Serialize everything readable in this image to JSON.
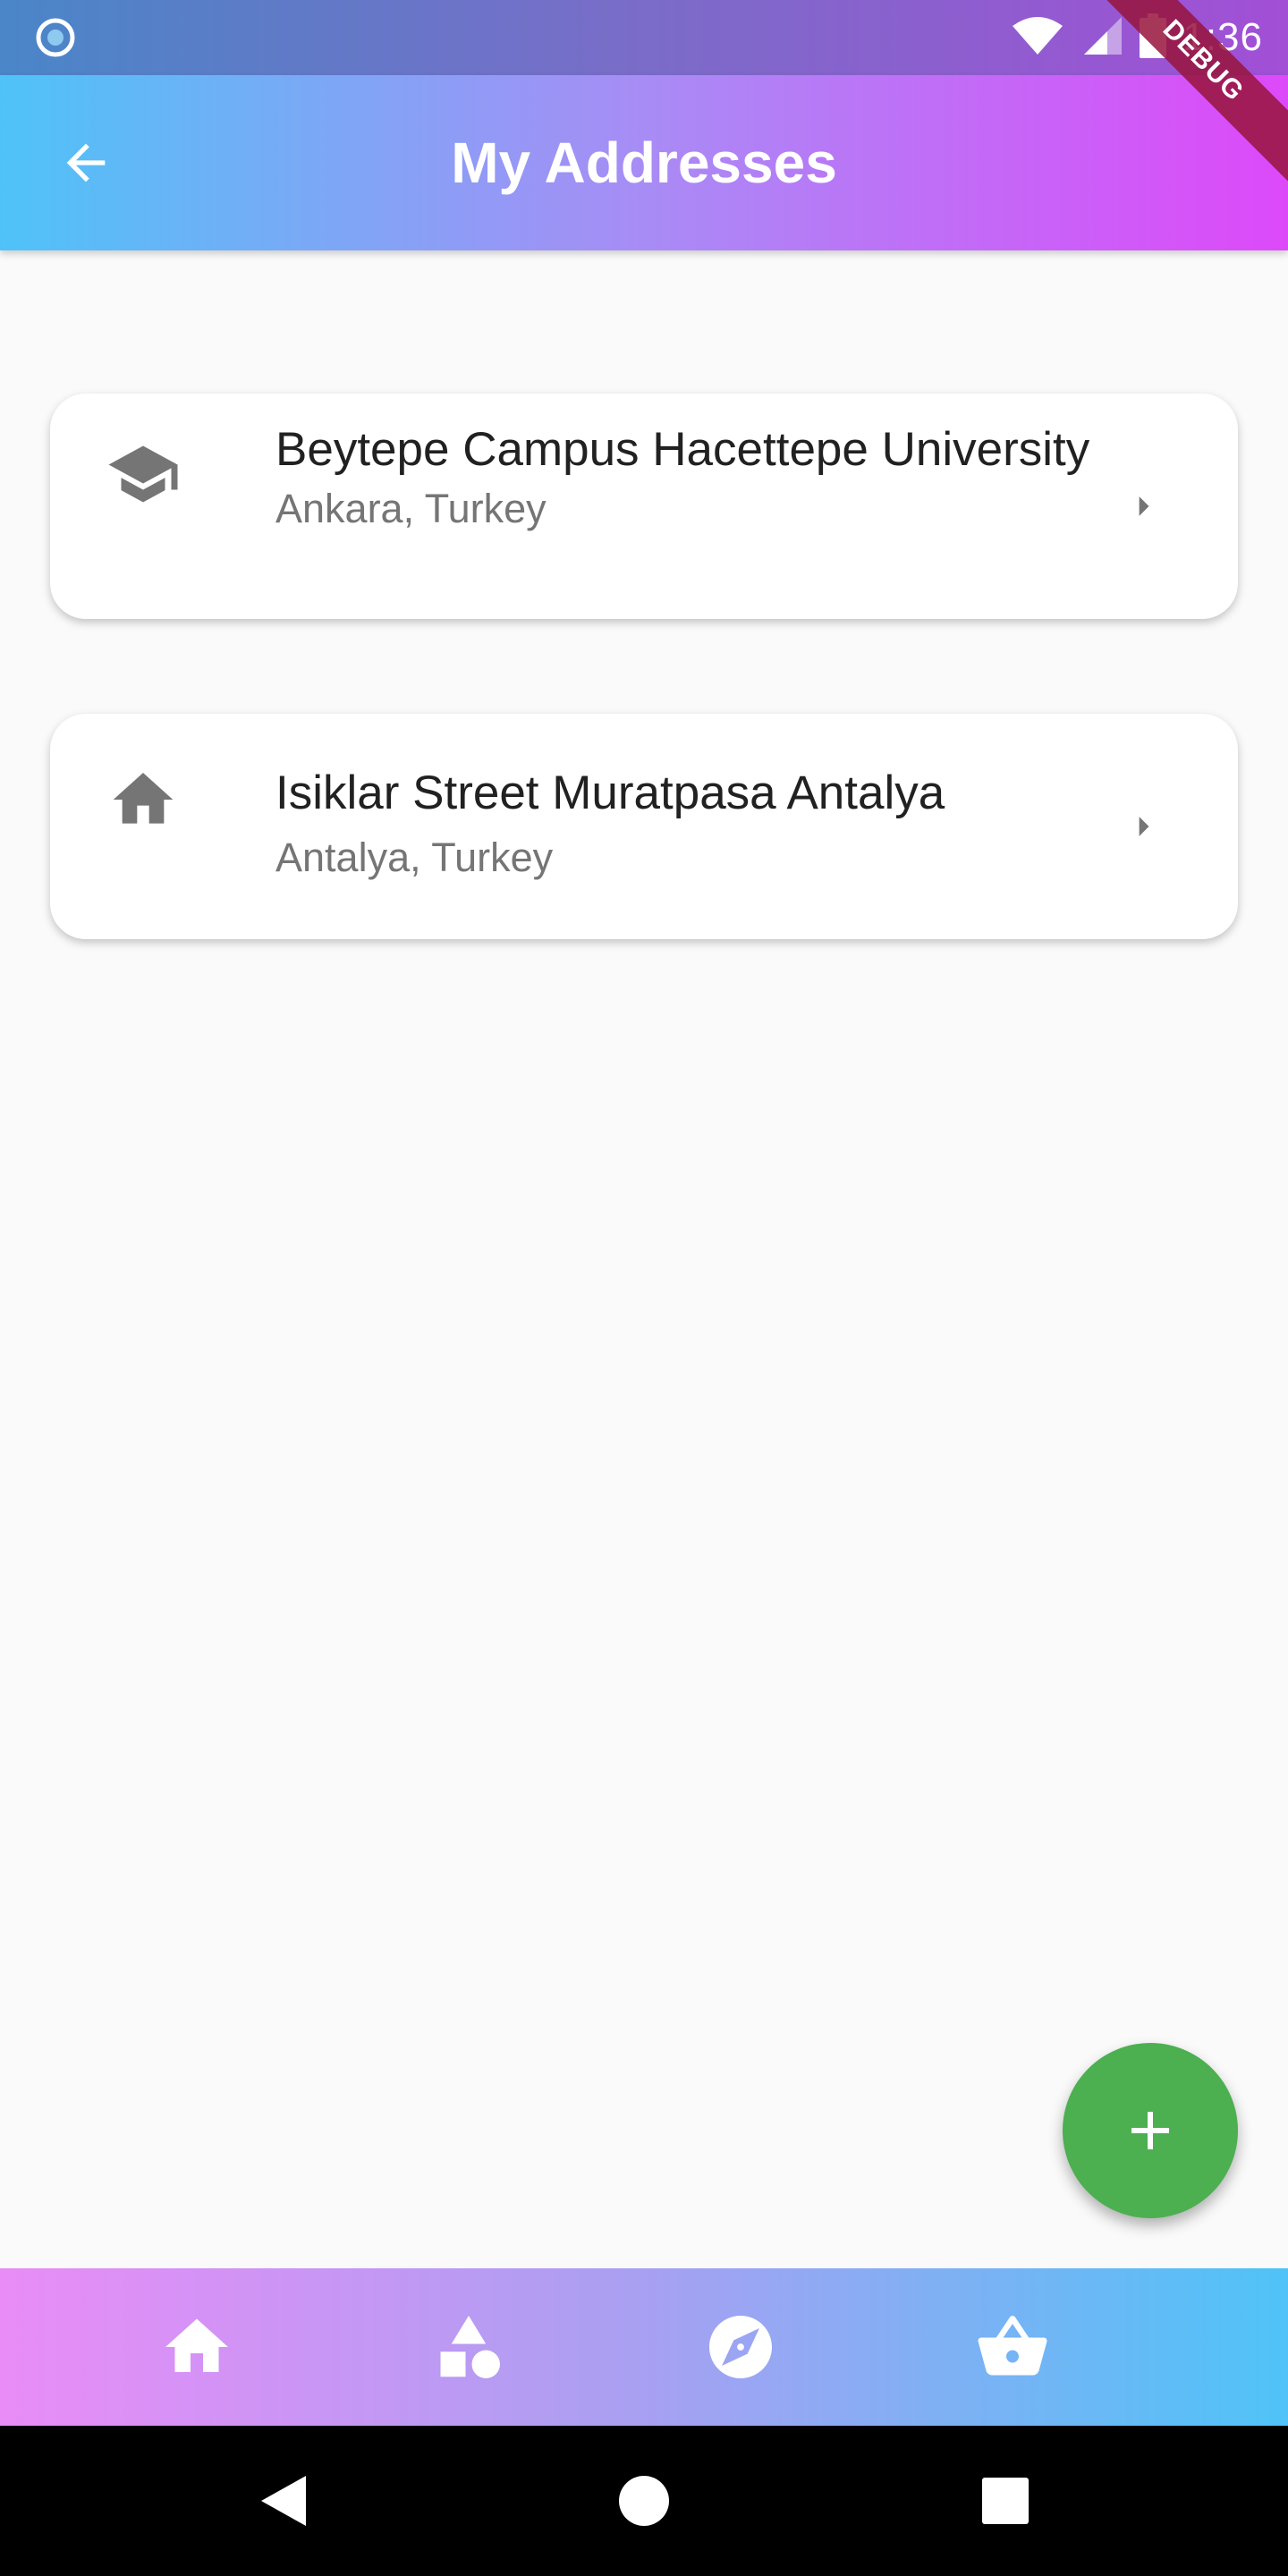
{
  "status_bar": {
    "time": "1:36"
  },
  "debug_banner": {
    "label": "DEBUG"
  },
  "app_bar": {
    "title": "My Addresses",
    "back_icon": "arrow-back-icon",
    "gradient": [
      "#4fc3f7",
      "#dd49f9"
    ]
  },
  "addresses": [
    {
      "icon": "school-icon",
      "title": "Beytepe Campus Hacettepe University",
      "subtitle": "Ankara, Turkey"
    },
    {
      "icon": "home-icon",
      "title": "Isiklar Street Muratpasa Antalya",
      "subtitle": "Antalya, Turkey"
    }
  ],
  "fab": {
    "icon": "add-icon",
    "color": "#4caf50"
  },
  "bottom_nav": {
    "items": [
      {
        "icon": "home-icon"
      },
      {
        "icon": "category-icon"
      },
      {
        "icon": "explore-icon"
      },
      {
        "icon": "shopping-basket-icon"
      }
    ],
    "gradient": [
      "#e98cf7",
      "#4fc3f7"
    ]
  },
  "system_nav": {
    "items": [
      {
        "icon": "back-triangle-icon"
      },
      {
        "icon": "home-circle-icon"
      },
      {
        "icon": "recents-square-icon"
      }
    ]
  }
}
